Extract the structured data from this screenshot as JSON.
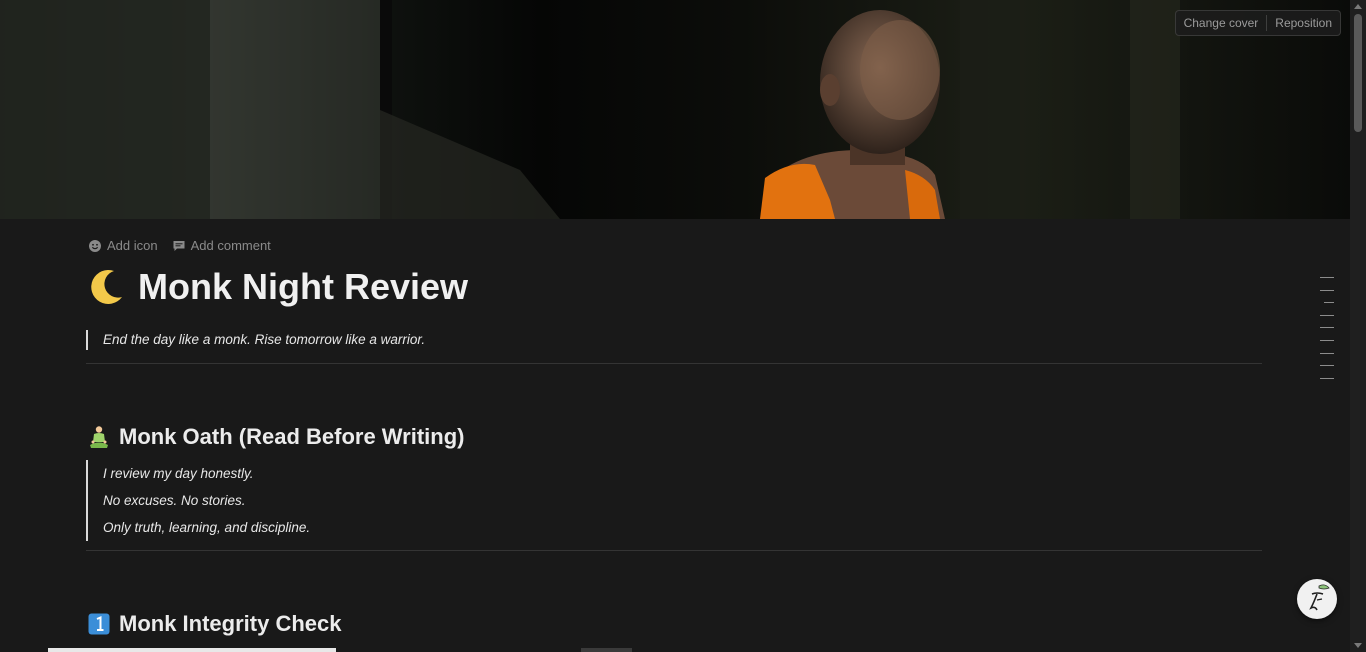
{
  "cover": {
    "change_cover_label": "Change cover",
    "reposition_label": "Reposition"
  },
  "page_tools": {
    "add_icon_label": "Add icon",
    "add_comment_label": "Add comment"
  },
  "page": {
    "title_emoji": "crescent-moon",
    "title": "Monk Night Review",
    "subtitle_quote": "End the day like a monk. Rise tomorrow like a warrior."
  },
  "sections": [
    {
      "emoji": "person-in-lotus-position",
      "heading": "Monk Oath (Read Before Writing)",
      "quote_lines": [
        "I review my day honestly.",
        "No excuses. No stories.",
        "Only truth, learning, and discipline."
      ]
    },
    {
      "emoji": "keycap-1",
      "heading": "Monk Integrity Check"
    }
  ],
  "toc": {
    "line_count": 9
  },
  "colors": {
    "background": "#191919",
    "text": "#e6e6e6",
    "quote_bar": "#d9d9d9",
    "divider": "#343434",
    "robe_orange": "#e2720f"
  }
}
